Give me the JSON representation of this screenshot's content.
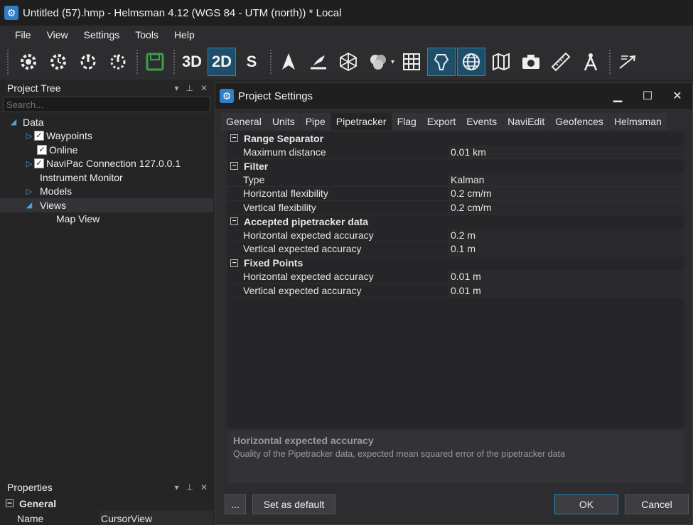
{
  "window": {
    "title": "Untitled (57).hmp - Helmsman 4.12 (WGS 84 - UTM (north)) * Local"
  },
  "menu": [
    "File",
    "View",
    "Settings",
    "Tools",
    "Help"
  ],
  "toolbar": {
    "btn_3d": "3D",
    "btn_2d": "2D",
    "btn_s": "S"
  },
  "project_tree": {
    "title": "Project Tree",
    "search_placeholder": "Search...",
    "items": [
      {
        "label": "Data"
      },
      {
        "label": "Waypoints"
      },
      {
        "label": "Online"
      },
      {
        "label": "NaviPac Connection 127.0.0.1"
      },
      {
        "label": "Instrument Monitor"
      },
      {
        "label": "Models"
      },
      {
        "label": "Views"
      },
      {
        "label": "Map View"
      }
    ]
  },
  "properties": {
    "title": "Properties",
    "group": "General",
    "rows": [
      {
        "key": "Name",
        "value": "CursorView"
      }
    ]
  },
  "dialog": {
    "title": "Project Settings",
    "tabs": [
      "General",
      "Units",
      "Pipe",
      "Pipetracker",
      "Flag",
      "Export",
      "Events",
      "NaviEdit",
      "Geofences",
      "Helmsman"
    ],
    "active_tab": "Pipetracker",
    "categories": [
      {
        "name": "Range Separator",
        "props": [
          {
            "k": "Maximum distance",
            "v": "0.01 km"
          }
        ]
      },
      {
        "name": "Filter",
        "props": [
          {
            "k": "Type",
            "v": "Kalman"
          },
          {
            "k": "Horizontal flexibility",
            "v": "0.2 cm/m"
          },
          {
            "k": "Vertical flexibility",
            "v": "0.2 cm/m"
          }
        ]
      },
      {
        "name": "Accepted pipetracker data",
        "props": [
          {
            "k": "Horizontal expected accuracy",
            "v": "0.2 m"
          },
          {
            "k": "Vertical expected accuracy",
            "v": "0.1 m"
          }
        ]
      },
      {
        "name": "Fixed Points",
        "props": [
          {
            "k": "Horizontal expected accuracy",
            "v": "0.01 m"
          },
          {
            "k": "Vertical expected accuracy",
            "v": "0.01 m"
          }
        ]
      }
    ],
    "description": {
      "title": "Horizontal expected accuracy",
      "text": "Quality of the Pipetracker data, expected mean squared error of the pipetracker data"
    },
    "buttons": {
      "more": "...",
      "set_default": "Set as default",
      "ok": "OK",
      "cancel": "Cancel"
    }
  }
}
